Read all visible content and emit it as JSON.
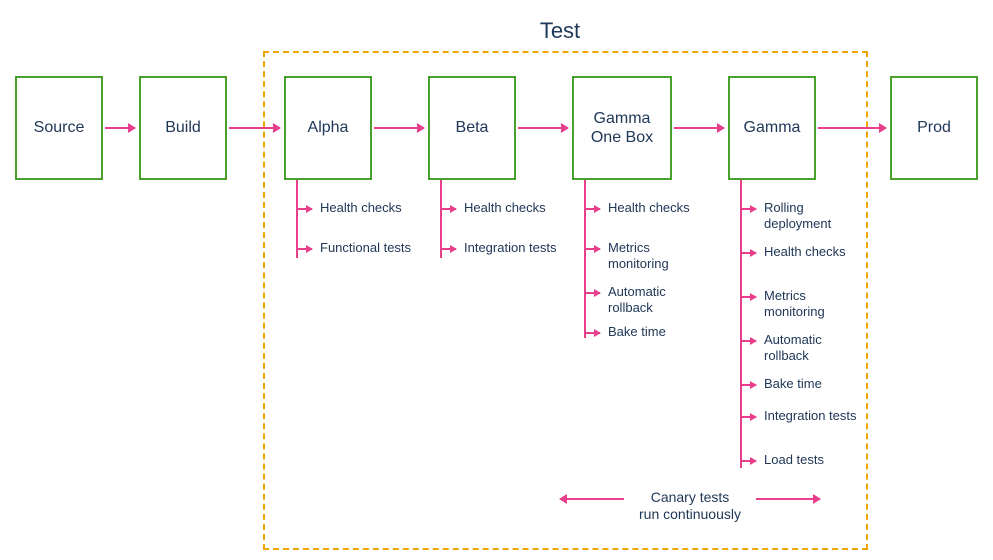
{
  "title": "Test",
  "stages": {
    "source": "Source",
    "build": "Build",
    "alpha": "Alpha",
    "beta": "Beta",
    "gamma_one_box": "Gamma\nOne Box",
    "gamma": "Gamma",
    "prod": "Prod"
  },
  "sub": {
    "alpha": [
      "Health checks",
      "Functional tests"
    ],
    "beta": [
      "Health checks",
      "Integration tests"
    ],
    "gamma_one_box": [
      "Health checks",
      "Metrics monitoring",
      "Automatic rollback",
      "Bake time"
    ],
    "gamma": [
      "Rolling deployment",
      "Health checks",
      "Metrics monitoring",
      "Automatic rollback",
      "Bake time",
      "Integration tests",
      "Load tests"
    ]
  },
  "canary_line1": "Canary tests",
  "canary_line2": "run continuously",
  "colors": {
    "box_border": "#4aa02c",
    "dashed": "#f0a500",
    "arrow": "#e83e8c",
    "text": "#203858"
  }
}
